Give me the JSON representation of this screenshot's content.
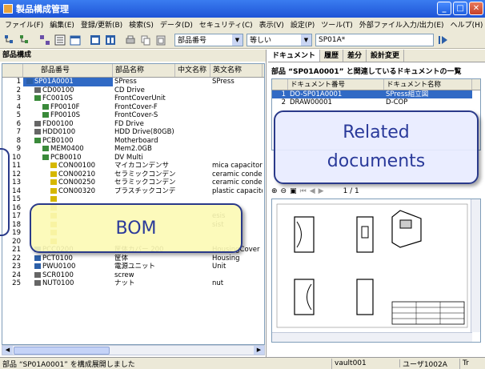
{
  "window": {
    "title": "製品構成管理"
  },
  "menu": [
    "ファイル(F)",
    "編集(E)",
    "登録/更新(B)",
    "検索(S)",
    "データ(D)",
    "セキュリティ(C)",
    "表示(V)",
    "設定(P)",
    "ツール(T)",
    "外部ファイル入力/出力(E)",
    "ヘルプ(H)"
  ],
  "toolbar": {
    "field_select": "部品番号",
    "op_select": "等しい",
    "search_value": "SP01A*"
  },
  "left": {
    "title": "部品構成",
    "columns": [
      "部品番号",
      "部品名称",
      "中文名称",
      "英文名称"
    ],
    "rows": [
      {
        "idx": "1",
        "code": "SP01A0001",
        "name": "SPress",
        "cn": "",
        "en": "SPress"
      },
      {
        "idx": "2",
        "code": "CD00100",
        "name": "CD Drive",
        "cn": "",
        "en": ""
      },
      {
        "idx": "3",
        "code": "FC0010S",
        "name": "FrontCoverUnit",
        "cn": "",
        "en": ""
      },
      {
        "idx": "4",
        "code": "FP0010F",
        "name": "FrontCover-F",
        "cn": "",
        "en": ""
      },
      {
        "idx": "5",
        "code": "FP0010S",
        "name": "FrontCover-S",
        "cn": "",
        "en": ""
      },
      {
        "idx": "6",
        "code": "FD00100",
        "name": "FD Drive",
        "cn": "",
        "en": ""
      },
      {
        "idx": "7",
        "code": "HDD0100",
        "name": "HDD Drive(80GB)",
        "cn": "",
        "en": ""
      },
      {
        "idx": "8",
        "code": "PCB0100",
        "name": "Motherboard",
        "cn": "",
        "en": ""
      },
      {
        "idx": "9",
        "code": "MEM0400",
        "name": "Mem2.0GB",
        "cn": "",
        "en": ""
      },
      {
        "idx": "10",
        "code": "PCB0010",
        "name": "DV Multi",
        "cn": "",
        "en": ""
      },
      {
        "idx": "11",
        "code": "CON00100",
        "name": "マイカコンデンサ",
        "cn": "",
        "en": "mica capacitor"
      },
      {
        "idx": "12",
        "code": "CON00210",
        "name": "セラミックコンデンサ",
        "cn": "",
        "en": "ceramic condens"
      },
      {
        "idx": "13",
        "code": "CON00250",
        "name": "セラミックコンデンサ",
        "cn": "",
        "en": "ceramic condens"
      },
      {
        "idx": "14",
        "code": "CON00320",
        "name": "プラスチックコンデンサ",
        "cn": "",
        "en": "plastic capacitor"
      },
      {
        "idx": "15",
        "code": "",
        "name": "",
        "cn": "",
        "en": ""
      },
      {
        "idx": "16",
        "code": "",
        "name": "",
        "cn": "",
        "en": ""
      },
      {
        "idx": "17",
        "code": "",
        "name": "",
        "cn": "",
        "en": "esis"
      },
      {
        "idx": "18",
        "code": "",
        "name": "",
        "cn": "",
        "en": "sist"
      },
      {
        "idx": "19",
        "code": "",
        "name": "",
        "cn": "",
        "en": ""
      },
      {
        "idx": "20",
        "code": "",
        "name": "",
        "cn": "",
        "en": ""
      },
      {
        "idx": "21",
        "code": "PCC0200",
        "name": "筐体カバー 200",
        "cn": "",
        "en": "HousingCover"
      },
      {
        "idx": "22",
        "code": "PCT0100",
        "name": "筐体",
        "cn": "",
        "en": "Housing"
      },
      {
        "idx": "23",
        "code": "PWU0100",
        "name": "電源ユニット",
        "cn": "",
        "en": "Unit"
      },
      {
        "idx": "24",
        "code": "SCR0100",
        "name": "screw",
        "cn": "",
        "en": ""
      },
      {
        "idx": "25",
        "code": "NUT0100",
        "name": "ナット",
        "cn": "",
        "en": "nut"
      }
    ]
  },
  "right": {
    "tabs": [
      "ドキュメント",
      "履歴",
      "差分",
      "設計変更"
    ],
    "doc_title": "部品 “SP01A0001” と関連しているドキュメントの一覧",
    "doc_columns": [
      "ドキュメント番号",
      "ドキュメント名称"
    ],
    "docs": [
      {
        "idx": "1",
        "num": "DO-SP01A0001",
        "name": "SPress組立図"
      },
      {
        "idx": "2",
        "num": "DRAW00001",
        "name": "D-COP"
      }
    ],
    "viewer_page": "1 / 1"
  },
  "status": {
    "message": "部品 “SP01A0001” を構成展開しました",
    "vault": "vault001",
    "user": "ユーザ1002A",
    "mode": "Tr"
  },
  "callouts": {
    "bom": "BOM",
    "related_line1": "Related",
    "related_line2": "documents"
  }
}
